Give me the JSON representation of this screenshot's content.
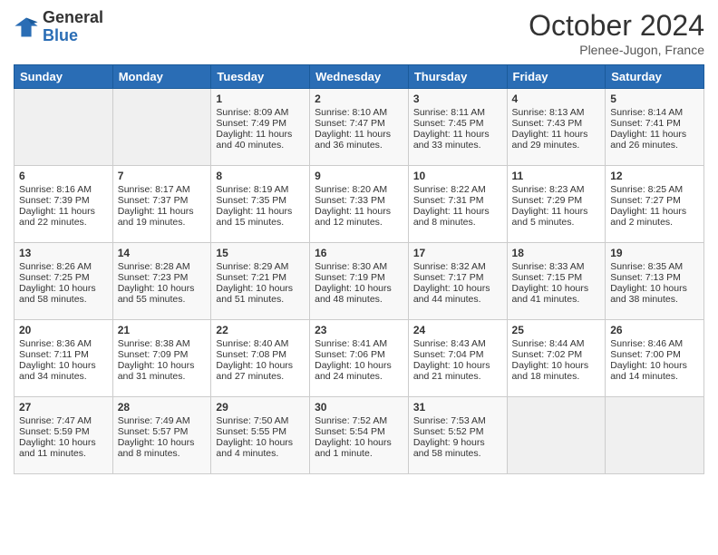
{
  "logo": {
    "general": "General",
    "blue": "Blue"
  },
  "header": {
    "title": "October 2024",
    "location": "Plenee-Jugon, France"
  },
  "days": [
    "Sunday",
    "Monday",
    "Tuesday",
    "Wednesday",
    "Thursday",
    "Friday",
    "Saturday"
  ],
  "weeks": [
    [
      {
        "day": "",
        "sunrise": "",
        "sunset": "",
        "daylight": "",
        "empty": true
      },
      {
        "day": "",
        "sunrise": "",
        "sunset": "",
        "daylight": "",
        "empty": true
      },
      {
        "day": "1",
        "sunrise": "Sunrise: 8:09 AM",
        "sunset": "Sunset: 7:49 PM",
        "daylight": "Daylight: 11 hours and 40 minutes.",
        "empty": false
      },
      {
        "day": "2",
        "sunrise": "Sunrise: 8:10 AM",
        "sunset": "Sunset: 7:47 PM",
        "daylight": "Daylight: 11 hours and 36 minutes.",
        "empty": false
      },
      {
        "day": "3",
        "sunrise": "Sunrise: 8:11 AM",
        "sunset": "Sunset: 7:45 PM",
        "daylight": "Daylight: 11 hours and 33 minutes.",
        "empty": false
      },
      {
        "day": "4",
        "sunrise": "Sunrise: 8:13 AM",
        "sunset": "Sunset: 7:43 PM",
        "daylight": "Daylight: 11 hours and 29 minutes.",
        "empty": false
      },
      {
        "day": "5",
        "sunrise": "Sunrise: 8:14 AM",
        "sunset": "Sunset: 7:41 PM",
        "daylight": "Daylight: 11 hours and 26 minutes.",
        "empty": false
      }
    ],
    [
      {
        "day": "6",
        "sunrise": "Sunrise: 8:16 AM",
        "sunset": "Sunset: 7:39 PM",
        "daylight": "Daylight: 11 hours and 22 minutes.",
        "empty": false
      },
      {
        "day": "7",
        "sunrise": "Sunrise: 8:17 AM",
        "sunset": "Sunset: 7:37 PM",
        "daylight": "Daylight: 11 hours and 19 minutes.",
        "empty": false
      },
      {
        "day": "8",
        "sunrise": "Sunrise: 8:19 AM",
        "sunset": "Sunset: 7:35 PM",
        "daylight": "Daylight: 11 hours and 15 minutes.",
        "empty": false
      },
      {
        "day": "9",
        "sunrise": "Sunrise: 8:20 AM",
        "sunset": "Sunset: 7:33 PM",
        "daylight": "Daylight: 11 hours and 12 minutes.",
        "empty": false
      },
      {
        "day": "10",
        "sunrise": "Sunrise: 8:22 AM",
        "sunset": "Sunset: 7:31 PM",
        "daylight": "Daylight: 11 hours and 8 minutes.",
        "empty": false
      },
      {
        "day": "11",
        "sunrise": "Sunrise: 8:23 AM",
        "sunset": "Sunset: 7:29 PM",
        "daylight": "Daylight: 11 hours and 5 minutes.",
        "empty": false
      },
      {
        "day": "12",
        "sunrise": "Sunrise: 8:25 AM",
        "sunset": "Sunset: 7:27 PM",
        "daylight": "Daylight: 11 hours and 2 minutes.",
        "empty": false
      }
    ],
    [
      {
        "day": "13",
        "sunrise": "Sunrise: 8:26 AM",
        "sunset": "Sunset: 7:25 PM",
        "daylight": "Daylight: 10 hours and 58 minutes.",
        "empty": false
      },
      {
        "day": "14",
        "sunrise": "Sunrise: 8:28 AM",
        "sunset": "Sunset: 7:23 PM",
        "daylight": "Daylight: 10 hours and 55 minutes.",
        "empty": false
      },
      {
        "day": "15",
        "sunrise": "Sunrise: 8:29 AM",
        "sunset": "Sunset: 7:21 PM",
        "daylight": "Daylight: 10 hours and 51 minutes.",
        "empty": false
      },
      {
        "day": "16",
        "sunrise": "Sunrise: 8:30 AM",
        "sunset": "Sunset: 7:19 PM",
        "daylight": "Daylight: 10 hours and 48 minutes.",
        "empty": false
      },
      {
        "day": "17",
        "sunrise": "Sunrise: 8:32 AM",
        "sunset": "Sunset: 7:17 PM",
        "daylight": "Daylight: 10 hours and 44 minutes.",
        "empty": false
      },
      {
        "day": "18",
        "sunrise": "Sunrise: 8:33 AM",
        "sunset": "Sunset: 7:15 PM",
        "daylight": "Daylight: 10 hours and 41 minutes.",
        "empty": false
      },
      {
        "day": "19",
        "sunrise": "Sunrise: 8:35 AM",
        "sunset": "Sunset: 7:13 PM",
        "daylight": "Daylight: 10 hours and 38 minutes.",
        "empty": false
      }
    ],
    [
      {
        "day": "20",
        "sunrise": "Sunrise: 8:36 AM",
        "sunset": "Sunset: 7:11 PM",
        "daylight": "Daylight: 10 hours and 34 minutes.",
        "empty": false
      },
      {
        "day": "21",
        "sunrise": "Sunrise: 8:38 AM",
        "sunset": "Sunset: 7:09 PM",
        "daylight": "Daylight: 10 hours and 31 minutes.",
        "empty": false
      },
      {
        "day": "22",
        "sunrise": "Sunrise: 8:40 AM",
        "sunset": "Sunset: 7:08 PM",
        "daylight": "Daylight: 10 hours and 27 minutes.",
        "empty": false
      },
      {
        "day": "23",
        "sunrise": "Sunrise: 8:41 AM",
        "sunset": "Sunset: 7:06 PM",
        "daylight": "Daylight: 10 hours and 24 minutes.",
        "empty": false
      },
      {
        "day": "24",
        "sunrise": "Sunrise: 8:43 AM",
        "sunset": "Sunset: 7:04 PM",
        "daylight": "Daylight: 10 hours and 21 minutes.",
        "empty": false
      },
      {
        "day": "25",
        "sunrise": "Sunrise: 8:44 AM",
        "sunset": "Sunset: 7:02 PM",
        "daylight": "Daylight: 10 hours and 18 minutes.",
        "empty": false
      },
      {
        "day": "26",
        "sunrise": "Sunrise: 8:46 AM",
        "sunset": "Sunset: 7:00 PM",
        "daylight": "Daylight: 10 hours and 14 minutes.",
        "empty": false
      }
    ],
    [
      {
        "day": "27",
        "sunrise": "Sunrise: 7:47 AM",
        "sunset": "Sunset: 5:59 PM",
        "daylight": "Daylight: 10 hours and 11 minutes.",
        "empty": false
      },
      {
        "day": "28",
        "sunrise": "Sunrise: 7:49 AM",
        "sunset": "Sunset: 5:57 PM",
        "daylight": "Daylight: 10 hours and 8 minutes.",
        "empty": false
      },
      {
        "day": "29",
        "sunrise": "Sunrise: 7:50 AM",
        "sunset": "Sunset: 5:55 PM",
        "daylight": "Daylight: 10 hours and 4 minutes.",
        "empty": false
      },
      {
        "day": "30",
        "sunrise": "Sunrise: 7:52 AM",
        "sunset": "Sunset: 5:54 PM",
        "daylight": "Daylight: 10 hours and 1 minute.",
        "empty": false
      },
      {
        "day": "31",
        "sunrise": "Sunrise: 7:53 AM",
        "sunset": "Sunset: 5:52 PM",
        "daylight": "Daylight: 9 hours and 58 minutes.",
        "empty": false
      },
      {
        "day": "",
        "sunrise": "",
        "sunset": "",
        "daylight": "",
        "empty": true
      },
      {
        "day": "",
        "sunrise": "",
        "sunset": "",
        "daylight": "",
        "empty": true
      }
    ]
  ]
}
